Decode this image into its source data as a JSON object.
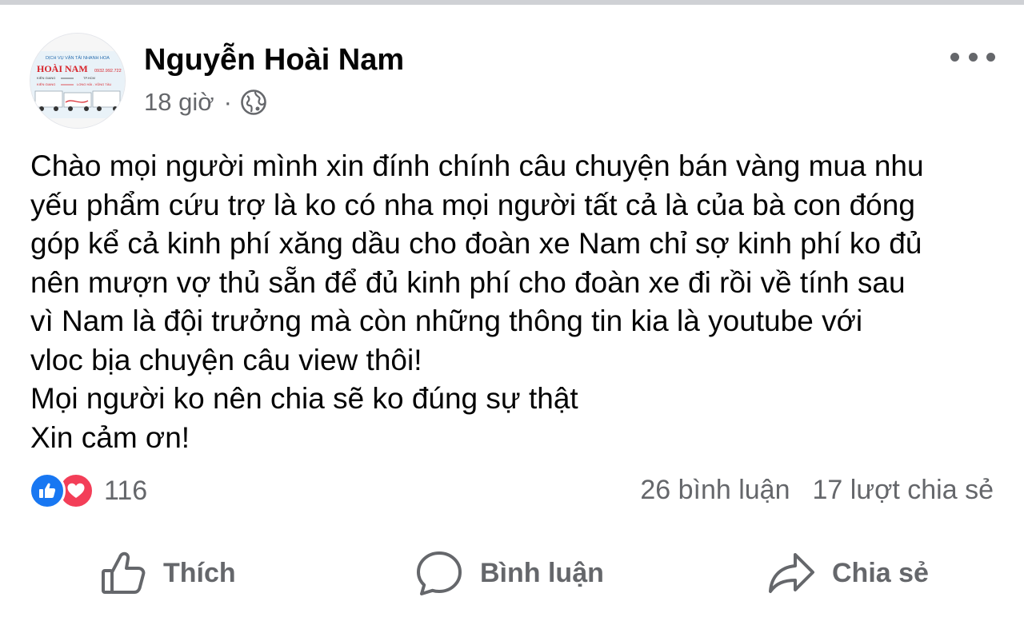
{
  "post": {
    "author": "Nguyễn Hoài Nam",
    "time": "18 giờ",
    "meta_separator": "·",
    "privacy_icon": "globe-icon",
    "avatar": {
      "top_line": "DỊCH VỤ VẬN TẢI NHANH HOA",
      "brand": "HOÀI NAM",
      "phone": "0932.992.722",
      "route_1_from": "KIÊN GIANG",
      "route_1_to": "TP.HCM",
      "route_2_from": "KIÊN GIANG",
      "route_2_to": "LONG HẢI - VŨNG TÀU"
    },
    "body_lines": [
      "Chào mọi người mình xin đính chính câu chuyện bán vàng mua nhu",
      "yếu phẩm cứu trợ là ko có nha mọi người tất cả là của bà con đóng",
      "góp kể cả kinh phí xăng dầu cho đoàn xe Nam chỉ sợ kinh phí ko đủ",
      "nên mượn vợ thủ sẵn để đủ kinh phí cho đoàn xe đi rồi về tính sau",
      "vì Nam là đội trưởng mà còn những thông tin kia là youtube với",
      "vloc bịa chuyện câu view thôi!",
      "Mọi người ko nên chia sẽ ko đúng sự thật",
      "Xin cảm ơn!"
    ]
  },
  "reactions": {
    "count": "116",
    "icons": [
      "like-reaction-icon",
      "love-reaction-icon"
    ]
  },
  "stats": {
    "comments": "26 bình luận",
    "shares": "17 lượt chia sẻ"
  },
  "actions": {
    "like": "Thích",
    "comment": "Bình luận",
    "share": "Chia sẻ"
  },
  "colors": {
    "secondary_text": "#65676b",
    "like_blue": "#1877f2",
    "love_red": "#f33e58"
  }
}
